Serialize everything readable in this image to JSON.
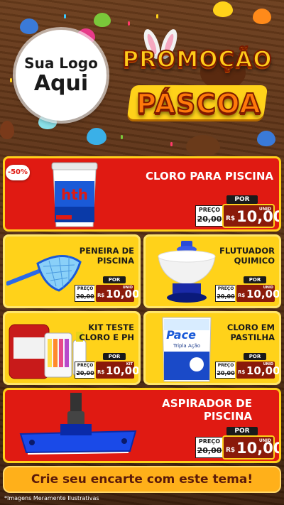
{
  "logo": {
    "line1": "Sua Logo",
    "line2": "Aqui"
  },
  "title": {
    "line1": "PROMOÇÃO",
    "line2": "PÁSCOA"
  },
  "discount_badge": "-50%",
  "price_labels": {
    "old_label": "PREÇO",
    "new_label": "POR",
    "currency": "R$",
    "unit": "UNID",
    "unit_short": "KIT"
  },
  "products": [
    {
      "name": "CLORO PARA PISCINA",
      "old_price": "20,00",
      "new_price": "10,00",
      "unit": "UNID"
    },
    {
      "name": "PENEIRA DE PISCINA",
      "old_price": "20,00",
      "new_price": "10,00",
      "unit": "UNID"
    },
    {
      "name": "FLUTUADOR QUIMICO",
      "old_price": "20,00",
      "new_price": "10,00",
      "unit": "UNID"
    },
    {
      "name": "KIT TESTE CLORO E PH",
      "old_price": "20,00",
      "new_price": "10,00",
      "unit": "KIT"
    },
    {
      "name": "CLORO EM PASTILHA",
      "old_price": "20,00",
      "new_price": "10,00",
      "unit": "UNID"
    },
    {
      "name": "ASPIRADOR DE PISCINA",
      "old_price": "20,00",
      "new_price": "10,00",
      "unit": "UNID"
    }
  ],
  "product_brands": {
    "bucket": "hth",
    "bag": "Pace",
    "bag_sub": "Tripla Ação"
  },
  "cta": "Crie seu encarte com este tema!",
  "footnote": "*Imagens Meramente Ilustrativas",
  "colors": {
    "red": "#e01a12",
    "yellow": "#ffd21a",
    "dark_red": "#8a1a0a",
    "wood": "#5a3116"
  }
}
